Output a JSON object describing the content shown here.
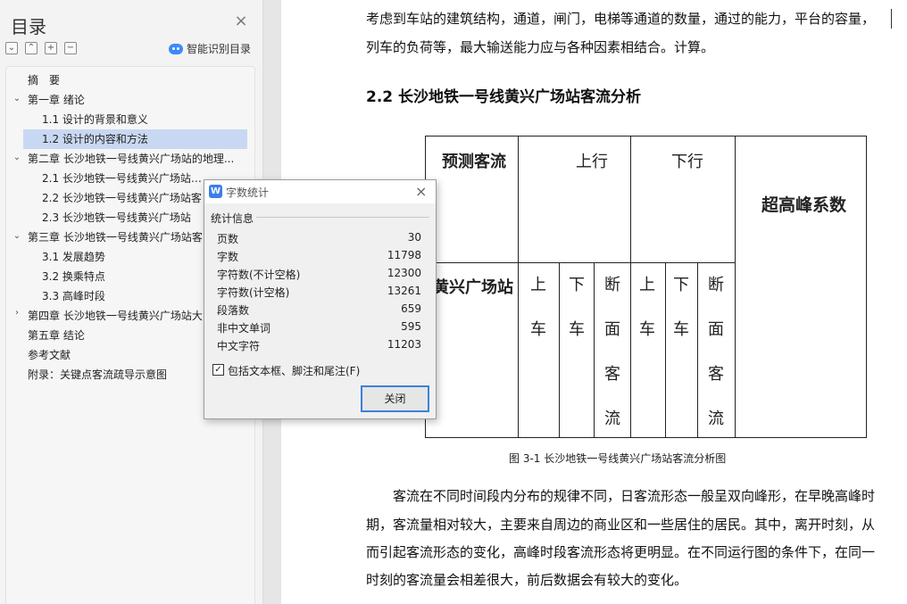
{
  "toc": {
    "title": "目录",
    "close_icon": "×",
    "smart_label": "智能识别目录",
    "items": [
      {
        "label": "摘　要"
      },
      {
        "label": "第一章 绪论"
      },
      {
        "label": "1.1 设计的背景和意义"
      },
      {
        "label": "1.2 设计的内容和方法"
      },
      {
        "label": "第二章 长沙地铁一号线黄兴广场站的地理..."
      },
      {
        "label": "2.1 长沙地铁一号线黄兴广场站地理位"
      },
      {
        "label": "2.2 长沙地铁一号线黄兴广场站客"
      },
      {
        "label": "2.3 长沙地铁一号线黄兴广场站"
      },
      {
        "label": "第三章 长沙地铁一号线黄兴广场站客"
      },
      {
        "label": "3.1 发展趋势"
      },
      {
        "label": "3.2 换乘特点"
      },
      {
        "label": "3.3 高峰时段"
      },
      {
        "label": "第四章 长沙地铁一号线黄兴广场站大"
      },
      {
        "label": "第五章 结论"
      },
      {
        "label": "参考文献"
      },
      {
        "label": "附录：关键点客流疏导示意图"
      }
    ]
  },
  "document": {
    "para_top_1": "考虑到车站的建筑结构，通道，闸门，电梯等通道的数量，通过的能力，平台的容量，",
    "para_top_2": "列车的负荷等，最大输送能力应与各种因素相结合。计算。",
    "heading": "2.2 长沙地铁一号线黄兴广场站客流分析",
    "table": {
      "corner": "预测客流",
      "up_header": "上行",
      "down_header": "下行",
      "peak_header": "超高峰系数",
      "station": "黄兴广场站",
      "sub_up": "上车",
      "sub_down": "下车",
      "sub_section": "断面客流"
    },
    "caption": "图 3-1 长沙地铁一号线黄兴广场站客流分析图",
    "para_bottom": [
      "客流在不同时间段内分布的规律不同，日客流形态一般呈双向峰形，在早晚高峰时",
      "期，客流量相对较大，主要来自周边的商业区和一些居住的居民。其中，离开时刻，从",
      "而引起客流形态的变化，高峰时段客流形态将更明显。在不同运行图的条件下，在同一",
      "时刻的客流量会相差很大，前后数据会有较大的变化。"
    ]
  },
  "dialog": {
    "logo": "W",
    "title": "字数统计",
    "close_icon": "×",
    "group_label": "统计信息",
    "stats": [
      {
        "label": "页数",
        "value": "30"
      },
      {
        "label": "字数",
        "value": "11798"
      },
      {
        "label": "字符数(不计空格)",
        "value": "12300"
      },
      {
        "label": "字符数(计空格)",
        "value": "13261"
      },
      {
        "label": "段落数",
        "value": "659"
      },
      {
        "label": "非中文单词",
        "value": "595"
      },
      {
        "label": "中文字符",
        "value": "11203"
      }
    ],
    "checkbox_label": "包括文本框、脚注和尾注(F)",
    "checkbox_checked": true,
    "close_button": "关闭"
  }
}
